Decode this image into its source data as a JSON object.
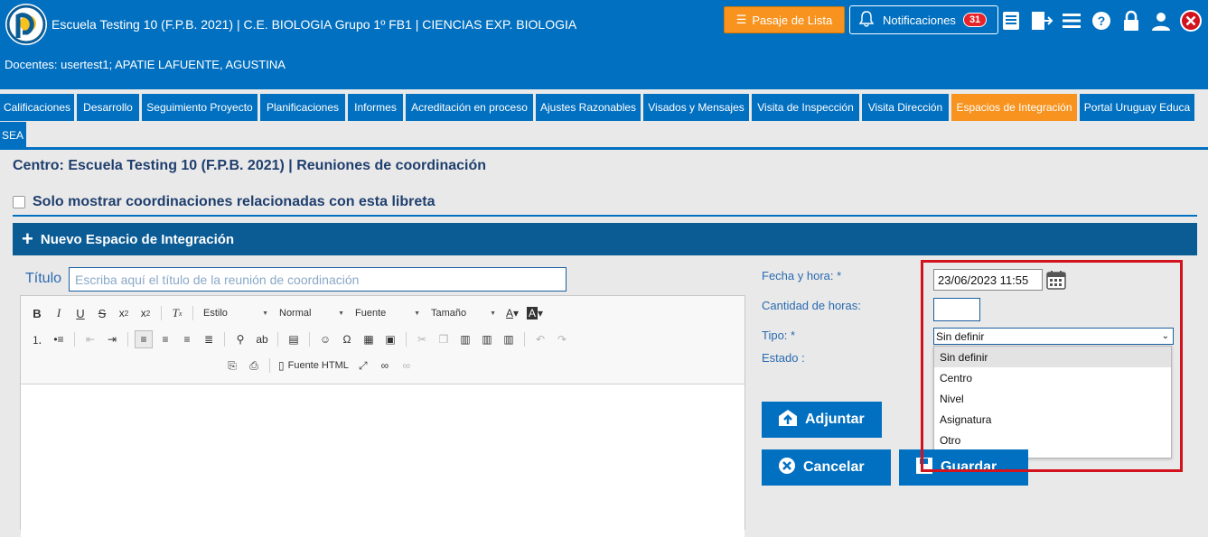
{
  "header": {
    "title": "Escuela Testing 10 (F.P.B. 2021) | C.E. BIOLOGIA Grupo 1º FB1 | CIENCIAS EXP. BIOLOGIA",
    "docentes": "Docentes: usertest1; APATIE LAFUENTE, AGUSTINA",
    "pasaje_label": "Pasaje de Lista",
    "notif_label": "Notificaciones",
    "notif_count": "31",
    "icons": [
      "report-icon",
      "export-icon",
      "menu-icon",
      "help-icon",
      "lock-icon",
      "user-icon",
      "close-icon"
    ]
  },
  "tabs": [
    {
      "label": "Calificaciones"
    },
    {
      "label": "Desarrollo"
    },
    {
      "label": "Seguimiento Proyecto"
    },
    {
      "label": "Planificaciones"
    },
    {
      "label": "Informes"
    },
    {
      "label": "Acreditación en proceso"
    },
    {
      "label": "Ajustes Razonables"
    },
    {
      "label": "Visados y Mensajes"
    },
    {
      "label": "Visita de Inspección"
    },
    {
      "label": "Visita Dirección"
    },
    {
      "label": "Espacios de Integración",
      "active": true
    },
    {
      "label": "Portal Uruguay Educa"
    },
    {
      "label": "SEA"
    }
  ],
  "page": {
    "title": "Centro: Escuela Testing 10 (F.P.B. 2021) | Reuniones de coordinación",
    "only_related_label": "Solo mostrar coordinaciones relacionadas con esta libreta",
    "section_title": "Nuevo Espacio de Integración"
  },
  "form": {
    "titulo_label": "Título",
    "titulo_placeholder": "Escriba aquí el título de la reunión de coordinación",
    "fecha_label": "Fecha y hora: *",
    "fecha_value": "23/06/2023 11:55",
    "horas_label": "Cantidad de horas:",
    "tipo_label": "Tipo: *",
    "tipo_value": "Sin definir",
    "estado_label": "Estado :",
    "tipo_options": [
      "Sin definir",
      "Centro",
      "Nivel",
      "Asignatura",
      "Otro"
    ],
    "adjuntar_label": "Adjuntar",
    "cancelar_label": "Cancelar",
    "guardar_label": "Guardar"
  },
  "editor": {
    "combo_estilo": "Estilo",
    "combo_formato": "Normal",
    "combo_fuente": "Fuente",
    "combo_tamano": "Tamaño",
    "source_label": "Fuente HTML"
  },
  "colors": {
    "brand_blue": "#0270c0",
    "accent_orange": "#f7931e",
    "section_blue": "#0b5b95",
    "highlight_red": "#d2121c",
    "badge_red": "#e8232a"
  }
}
